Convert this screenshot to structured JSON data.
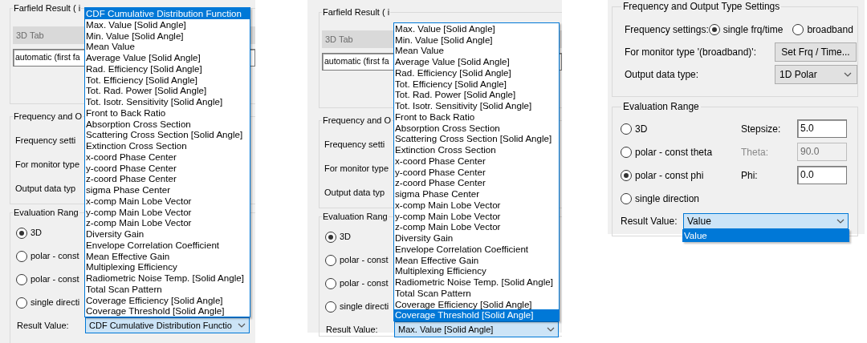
{
  "panels": [
    {
      "kind": "covered",
      "group_title": "Farfield Result ( i",
      "tab_field": {
        "value": "3D Tab",
        "disabled": true
      },
      "source_combo": "automatic (first fa",
      "freq_group_title": "Frequency and O",
      "freq_rows": [
        "Frequency setti",
        "For monitor type",
        "Output data typ"
      ],
      "eval_title": "Evaluation Rang",
      "radios": [
        {
          "label": "3D",
          "selected": true
        },
        {
          "label": "polar - const",
          "selected": false
        },
        {
          "label": "polar - const",
          "selected": false
        },
        {
          "label": "single directi",
          "selected": false
        }
      ],
      "result_label": "Result Value:",
      "result_combo": "CDF Cumulative Distribution Functio",
      "dropdown": [
        {
          "label": "CDF Cumulative Distribution Function",
          "selected": true
        },
        {
          "label": "Max. Value [Solid Angle]",
          "selected": false
        },
        {
          "label": "Min. Value [Solid Angle]",
          "selected": false
        },
        {
          "label": "Mean Value",
          "selected": false
        },
        {
          "label": "Average Value [Solid Angle]",
          "selected": false
        },
        {
          "label": "Rad. Efficiency [Solid Angle]",
          "selected": false
        },
        {
          "label": "Tot. Efficiency [Solid Angle]",
          "selected": false
        },
        {
          "label": "Tot. Rad. Power [Solid Angle]",
          "selected": false
        },
        {
          "label": "Tot. Isotr. Sensitivity [Solid Angle]",
          "selected": false
        },
        {
          "label": "Front to Back Ratio",
          "selected": false
        },
        {
          "label": "Absorption Cross Section",
          "selected": false
        },
        {
          "label": "Scattering Cross Section [Solid Angle]",
          "selected": false
        },
        {
          "label": "Extinction Cross Section",
          "selected": false
        },
        {
          "label": "x-coord Phase Center",
          "selected": false
        },
        {
          "label": "y-coord Phase Center",
          "selected": false
        },
        {
          "label": "z-coord Phase Center",
          "selected": false
        },
        {
          "label": "sigma Phase Center",
          "selected": false
        },
        {
          "label": "x-comp Main Lobe Vector",
          "selected": false
        },
        {
          "label": "y-comp Main Lobe Vector",
          "selected": false
        },
        {
          "label": "z-comp Main Lobe Vector",
          "selected": false
        },
        {
          "label": "Diversity Gain",
          "selected": false
        },
        {
          "label": "Envelope Correlation Coefficient",
          "selected": false
        },
        {
          "label": "Mean Effective Gain",
          "selected": false
        },
        {
          "label": "Multiplexing Efficiency",
          "selected": false
        },
        {
          "label": "Radiometric Noise Temp. [Solid Angle]",
          "selected": false
        },
        {
          "label": "Total Scan Pattern",
          "selected": false
        },
        {
          "label": "Coverage Efficiency [Solid Angle]",
          "selected": false
        },
        {
          "label": "Coverage Threshold [Solid Angle]",
          "selected": false
        }
      ]
    },
    {
      "kind": "covered",
      "group_title": "Farfield Result ( i",
      "tab_field": {
        "value": "3D Tab",
        "disabled": true
      },
      "source_combo": "automatic (first fa",
      "freq_group_title": "Frequency and O",
      "freq_rows": [
        "Frequency setti",
        "For monitor type",
        "Output data typ"
      ],
      "eval_title": "Evaluation Rang",
      "radios": [
        {
          "label": "3D",
          "selected": true
        },
        {
          "label": "polar - const",
          "selected": false
        },
        {
          "label": "polar - const",
          "selected": false
        },
        {
          "label": "single directi",
          "selected": false
        }
      ],
      "result_label": "Result Value:",
      "result_combo": "Max. Value [Solid Angle]",
      "dropdown": [
        {
          "label": "Max. Value [Solid Angle]",
          "selected": false
        },
        {
          "label": "Min. Value [Solid Angle]",
          "selected": false
        },
        {
          "label": "Mean Value",
          "selected": false
        },
        {
          "label": "Average Value [Solid Angle]",
          "selected": false
        },
        {
          "label": "Rad. Efficiency [Solid Angle]",
          "selected": false
        },
        {
          "label": "Tot. Efficiency [Solid Angle]",
          "selected": false
        },
        {
          "label": "Tot. Rad. Power [Solid Angle]",
          "selected": false
        },
        {
          "label": "Tot. Isotr. Sensitivity [Solid Angle]",
          "selected": false
        },
        {
          "label": "Front to Back Ratio",
          "selected": false
        },
        {
          "label": "Absorption Cross Section",
          "selected": false
        },
        {
          "label": "Scattering Cross Section [Solid Angle]",
          "selected": false
        },
        {
          "label": "Extinction Cross Section",
          "selected": false
        },
        {
          "label": "x-coord Phase Center",
          "selected": false
        },
        {
          "label": "y-coord Phase Center",
          "selected": false
        },
        {
          "label": "z-coord Phase Center",
          "selected": false
        },
        {
          "label": "sigma Phase Center",
          "selected": false
        },
        {
          "label": "x-comp Main Lobe Vector",
          "selected": false
        },
        {
          "label": "y-comp Main Lobe Vector",
          "selected": false
        },
        {
          "label": "z-comp Main Lobe Vector",
          "selected": false
        },
        {
          "label": "Diversity Gain",
          "selected": false
        },
        {
          "label": "Envelope Correlation Coefficient",
          "selected": false
        },
        {
          "label": "Mean Effective Gain",
          "selected": false
        },
        {
          "label": "Multiplexing Efficiency",
          "selected": false
        },
        {
          "label": "Radiometric Noise Temp. [Solid Angle]",
          "selected": false
        },
        {
          "label": "Total Scan Pattern",
          "selected": false
        },
        {
          "label": "Coverage Efficiency [Solid Angle]",
          "selected": false
        },
        {
          "label": "Coverage Threshold [Solid Angle]",
          "selected": true
        }
      ]
    },
    {
      "kind": "full",
      "freq_group_title": "Frequency and Output Type Settings",
      "freq_label": "Frequency settings:",
      "freq_options": [
        {
          "label": "single frq/time",
          "selected": true
        },
        {
          "label": "broadband",
          "selected": false
        }
      ],
      "monitor_label": "For monitor type '(broadband)':",
      "monitor_button": "Set Frq / Time...",
      "output_label": "Output data type:",
      "output_combo": "1D Polar",
      "eval_title": "Evaluation Range",
      "radios": [
        {
          "label": "3D",
          "selected": false
        },
        {
          "label": "polar - const theta",
          "selected": false
        },
        {
          "label": "polar - const phi",
          "selected": true
        },
        {
          "label": "single direction",
          "selected": false
        }
      ],
      "params": [
        {
          "label": "Stepsize:",
          "value": "5.0",
          "disabled": false
        },
        {
          "label": "Theta:",
          "value": "90.0",
          "disabled": true
        },
        {
          "label": "Phi:",
          "value": "0.0",
          "disabled": false
        }
      ],
      "result_label": "Result Value:",
      "result_combo": "Value",
      "dropdown": [
        {
          "label": "Value",
          "selected": true
        }
      ]
    }
  ]
}
